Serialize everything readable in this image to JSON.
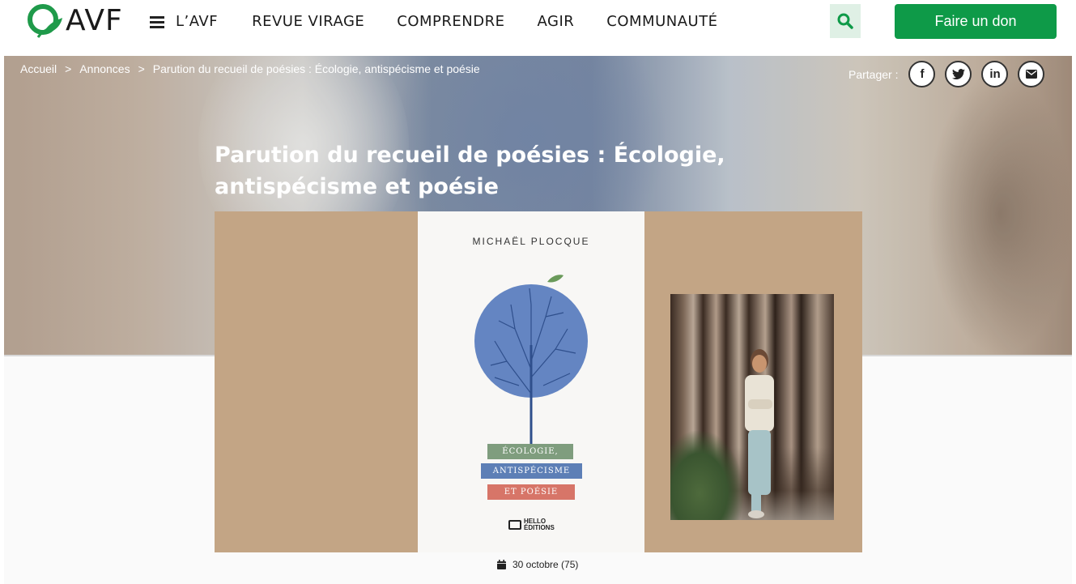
{
  "header": {
    "logo_text": "AVF",
    "nav": [
      {
        "label": "L’AVF"
      },
      {
        "label": "REVUE VIRAGE"
      },
      {
        "label": "COMPRENDRE"
      },
      {
        "label": "AGIR"
      },
      {
        "label": "COMMUNAUTÉ"
      }
    ],
    "search_icon": "search-icon",
    "donate_label": "Faire un don",
    "brand_color": "#0e9a48"
  },
  "breadcrumb": {
    "items": [
      "Accueil",
      "Annonces",
      "Parution du recueil de poésies : Écologie, antispécisme et poésie"
    ],
    "separator": ">"
  },
  "share": {
    "label": "Partager :",
    "buttons": [
      {
        "icon": "facebook-icon",
        "glyph": "f"
      },
      {
        "icon": "twitter-icon",
        "glyph": "t"
      },
      {
        "icon": "linkedin-icon",
        "glyph": "in"
      },
      {
        "icon": "mail-icon",
        "glyph": "✉"
      }
    ]
  },
  "article": {
    "title": "Parution du recueil de poésies : Écologie, antispécisme et poésie",
    "date": "30 octobre (75)"
  },
  "book_cover": {
    "author": "MICHAËL PLOCQUE",
    "labels": [
      "ÉCOLOGIE,",
      "ANTISPÉCISME",
      "ET POÉSIE"
    ],
    "publisher_line1": "HELLO",
    "publisher_line2": "ÉDITIONS"
  }
}
